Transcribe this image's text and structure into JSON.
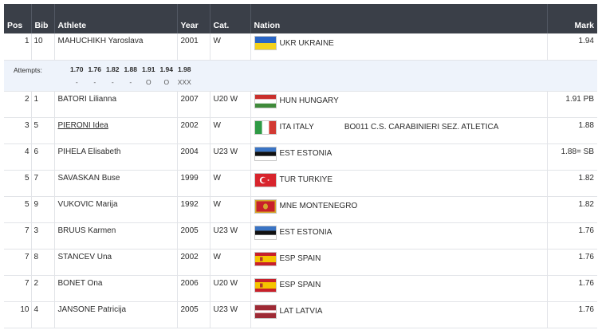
{
  "headers": {
    "pos": "Pos",
    "bib": "Bib",
    "athlete": "Athlete",
    "year": "Year",
    "cat": "Cat.",
    "nation": "Nation",
    "mark": "Mark"
  },
  "attempts": {
    "label": "Attempts:",
    "heights": [
      "1.70",
      "1.76",
      "1.82",
      "1.88",
      "1.91",
      "1.94",
      "1.98"
    ],
    "results": [
      "-",
      "-",
      "-",
      "-",
      "O",
      "O",
      "XXX"
    ]
  },
  "rows": [
    {
      "pos": "1",
      "bib": "10",
      "athlete": "MAHUCHIKH Yaroslava",
      "year": "2001",
      "cat": "W",
      "nation": "UKR UKRAINE",
      "flag": "ukr-flag-icon",
      "club": "",
      "mark": "1.94"
    },
    {
      "pos": "2",
      "bib": "1",
      "athlete": "BATORI Lilianna",
      "year": "2007",
      "cat": "U20 W",
      "nation": "HUN HUNGARY",
      "flag": "hun-flag-icon",
      "club": "",
      "mark": "1.91 PB"
    },
    {
      "pos": "3",
      "bib": "5",
      "athlete": "PIERONI Idea",
      "year": "2002",
      "cat": "W",
      "nation": "ITA ITALY",
      "flag": "ita-flag-icon",
      "club": "BO011 C.S. CARABINIERI SEZ. ATLETICA",
      "mark": "1.88"
    },
    {
      "pos": "4",
      "bib": "6",
      "athlete": "PIHELA Elisabeth",
      "year": "2004",
      "cat": "U23 W",
      "nation": "EST ESTONIA",
      "flag": "est-flag-icon",
      "club": "",
      "mark": "1.88= SB"
    },
    {
      "pos": "5",
      "bib": "7",
      "athlete": "SAVASKAN Buse",
      "year": "1999",
      "cat": "W",
      "nation": "TUR TURKIYE",
      "flag": "tur-flag-icon",
      "club": "",
      "mark": "1.82"
    },
    {
      "pos": "5",
      "bib": "9",
      "athlete": "VUKOVIC Marija",
      "year": "1992",
      "cat": "W",
      "nation": "MNE MONTENEGRO",
      "flag": "mne-flag-icon",
      "club": "",
      "mark": "1.82"
    },
    {
      "pos": "7",
      "bib": "3",
      "athlete": "BRUUS Karmen",
      "year": "2005",
      "cat": "U23 W",
      "nation": "EST ESTONIA",
      "flag": "est-flag-icon",
      "club": "",
      "mark": "1.76"
    },
    {
      "pos": "7",
      "bib": "8",
      "athlete": "STANCEV Una",
      "year": "2002",
      "cat": "W",
      "nation": "ESP SPAIN",
      "flag": "esp-flag-icon",
      "club": "",
      "mark": "1.76"
    },
    {
      "pos": "7",
      "bib": "2",
      "athlete": "BONET Ona",
      "year": "2006",
      "cat": "U20 W",
      "nation": "ESP SPAIN",
      "flag": "esp-flag-icon",
      "club": "",
      "mark": "1.76"
    },
    {
      "pos": "10",
      "bib": "4",
      "athlete": "JANSONE Patricija",
      "year": "2005",
      "cat": "U23 W",
      "nation": "LAT LATVIA",
      "flag": "lat-flag-icon",
      "club": "",
      "mark": "1.76"
    }
  ]
}
